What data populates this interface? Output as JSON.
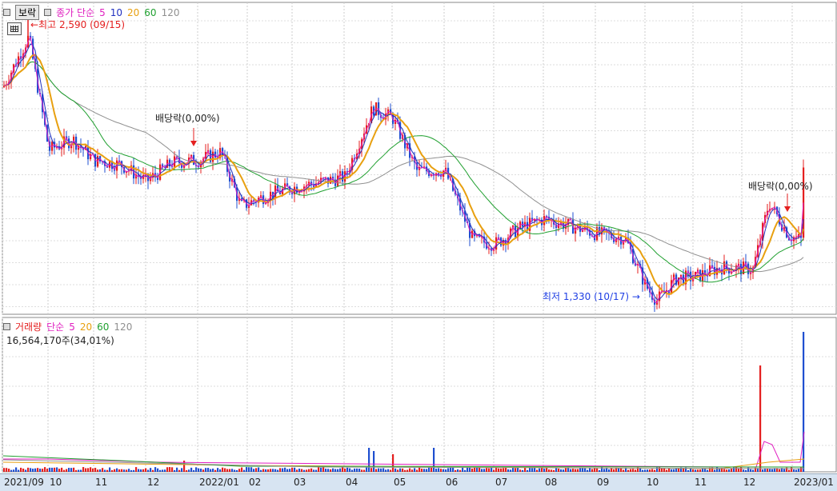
{
  "stock_name": "보락",
  "price_legend": {
    "label": "종가 단순",
    "ma5": "5",
    "ma10": "10",
    "ma20": "20",
    "ma60": "60",
    "ma120": "120"
  },
  "volume_legend": {
    "label": "거래량",
    "ma_label": "단순",
    "ma5": "5",
    "ma20": "20",
    "ma60": "60",
    "ma120": "120"
  },
  "volume_info": "16,564,170주(34,01%)",
  "annotations": {
    "high": "←최고 2,590 (09/15)",
    "low": "최저 1,330 (10/17) →",
    "dividend1": "배당락(0,00%)",
    "dividend2": "배당락(0,00%)"
  },
  "colors": {
    "up": "#e41f1f",
    "down": "#1f4fd0",
    "ma5": "#e020c0",
    "ma10": "#2030c0",
    "ma20": "#e8a010",
    "ma60": "#20a030",
    "ma120": "#909090"
  },
  "x_ticks": [
    "2021/09",
    "10",
    "11",
    "12",
    "2022/01",
    "02",
    "03",
    "04",
    "05",
    "06",
    "07",
    "08",
    "09",
    "10",
    "11",
    "12",
    "2023/01"
  ],
  "chart_data": {
    "type": "candlestick",
    "x": [
      "2021/09",
      "2021/10",
      "2021/11",
      "2021/12",
      "2022/01",
      "2022/02",
      "2022/03",
      "2022/04",
      "2022/05",
      "2022/06",
      "2022/07",
      "2022/08",
      "2022/09",
      "2022/10",
      "2022/11",
      "2022/12",
      "2023/01"
    ],
    "close_approx": [
      2350,
      2050,
      2000,
      1960,
      2000,
      1780,
      1850,
      1900,
      2150,
      1920,
      1600,
      1700,
      1600,
      1400,
      1440,
      1500,
      2150
    ],
    "high": {
      "value": 2590,
      "date": "09/15"
    },
    "low": {
      "value": 1330,
      "date": "10/17"
    },
    "series": [
      {
        "name": "5",
        "type": "moving_average"
      },
      {
        "name": "10",
        "type": "moving_average"
      },
      {
        "name": "20",
        "type": "moving_average"
      },
      {
        "name": "60",
        "type": "moving_average"
      },
      {
        "name": "120",
        "type": "moving_average"
      }
    ],
    "volume_last": "16,564,170",
    "volume_pct": "34,01%",
    "grid": true
  }
}
